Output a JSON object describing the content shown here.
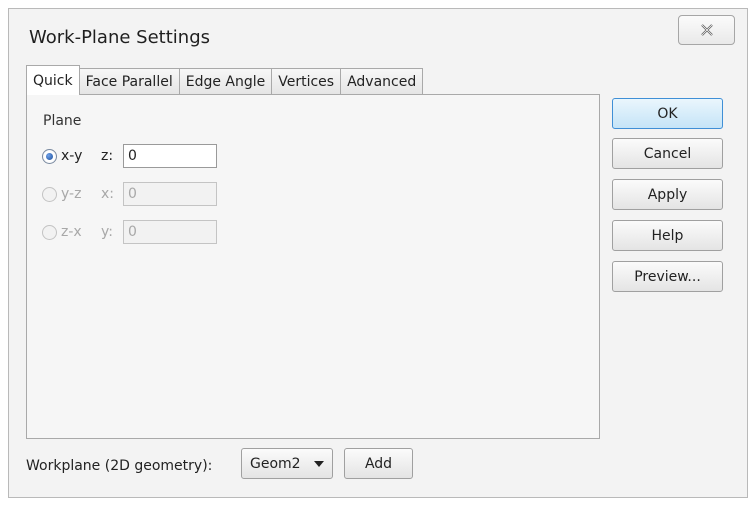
{
  "window": {
    "title": "Work-Plane Settings",
    "close_icon": "close-icon"
  },
  "tabs": [
    {
      "label": "Quick",
      "active": true
    },
    {
      "label": "Face Parallel",
      "active": false
    },
    {
      "label": "Edge Angle",
      "active": false
    },
    {
      "label": "Vertices",
      "active": false
    },
    {
      "label": "Advanced",
      "active": false
    }
  ],
  "plane": {
    "label": "Plane",
    "options": [
      {
        "label": "x-y",
        "coord": "z:",
        "value": "0",
        "selected": true,
        "enabled": true
      },
      {
        "label": "y-z",
        "coord": "x:",
        "value": "0",
        "selected": false,
        "enabled": false
      },
      {
        "label": "z-x",
        "coord": "y:",
        "value": "0",
        "selected": false,
        "enabled": false
      }
    ]
  },
  "buttons": {
    "ok": "OK",
    "cancel": "Cancel",
    "apply": "Apply",
    "help": "Help",
    "preview": "Preview..."
  },
  "workplane": {
    "label": "Workplane (2D geometry):",
    "selected": "Geom2",
    "add_label": "Add"
  },
  "colors": {
    "default_button": "#c5e4f7",
    "default_border": "#3f8fd6",
    "radio_fill": "#1b4f9c"
  }
}
